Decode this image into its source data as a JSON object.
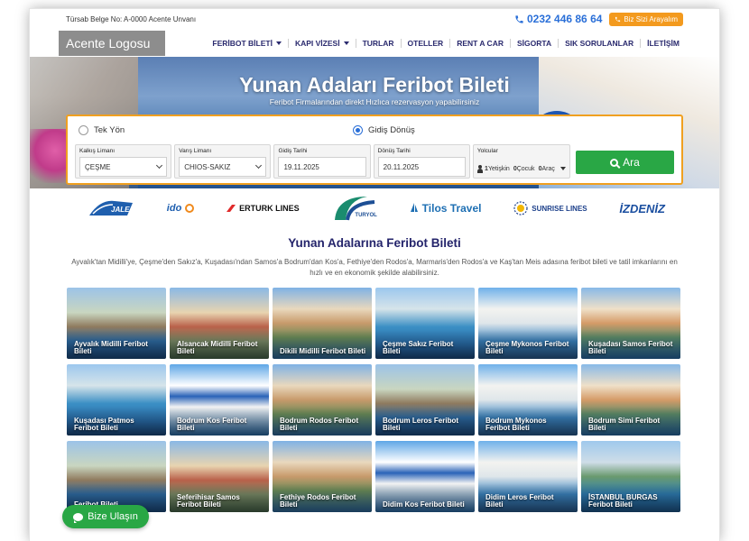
{
  "topbar": {
    "license": "Türsab Belge No: A-0000 Acente Unvanı",
    "phone": "0232 446 86 64",
    "callback_label": "Biz Sizi Arayalım"
  },
  "nav": {
    "logo": "Acente Logosu",
    "items": [
      {
        "label": "FERİBOT BİLETİ",
        "dropdown": true
      },
      {
        "label": "KAPI VİZESİ",
        "dropdown": true
      },
      {
        "label": "TURLAR",
        "dropdown": false
      },
      {
        "label": "OTELLER",
        "dropdown": false
      },
      {
        "label": "RENT A CAR",
        "dropdown": false
      },
      {
        "label": "SİGORTA",
        "dropdown": false
      },
      {
        "label": "SIK SORULANLAR",
        "dropdown": false
      },
      {
        "label": "İLETİŞİM",
        "dropdown": false
      }
    ]
  },
  "hero": {
    "title": "Yunan Adaları Feribot Bileti",
    "subtitle": "Feribot Firmalarından direkt Hızlıca rezervasyon yapabilirsiniz"
  },
  "search": {
    "one_way": "Tek Yön",
    "round_trip": "Gidiş Dönüş",
    "selected": "round_trip",
    "departure_label": "Kalkış Limanı",
    "departure_value": "ÇEŞME",
    "arrival_label": "Varış Limanı",
    "arrival_value": "CHIOS-SAKIZ",
    "depart_date_label": "Gidiş Tarihi",
    "depart_date": "19.11.2025",
    "return_date_label": "Dönüş Tarihi",
    "return_date": "20.11.2025",
    "passengers_label": "Yolcular",
    "adults": "1",
    "adults_label": "Yetişkin",
    "children": "0",
    "children_label": "Çocuk",
    "vehicles": "0",
    "vehicles_label": "Araç",
    "search_button": "Ara"
  },
  "companies": [
    "JALE",
    "ido",
    "ERTURK LINES",
    "TURYOL",
    "Tilos Travel",
    "SUNRISE LINES",
    "İZDENİZ"
  ],
  "section": {
    "title": "Yunan Adalarına Feribot Bileti",
    "description": "Ayvalık'tan Midilli'ye, Çeşme'den Sakız'a, Kuşadası'ndan Samos'a Bodrum'dan Kos'a, Fethiye'den Rodos'a, Marmaris'den Rodos'a ve Kaş'tan Meis adasına feribot bileti ve tatil imkanlarını en hızlı ve en ekonomik şekilde alabilirsiniz."
  },
  "routes": [
    {
      "label": "Ayvalık Midilli Feribot Bileti",
      "theme": "harbor"
    },
    {
      "label": "Alsancak Midilli Feribot Bileti",
      "theme": "church"
    },
    {
      "label": "Dikili Midilli Feribot Bileti",
      "theme": "hill"
    },
    {
      "label": "Çeşme Sakız Feribot Bileti",
      "theme": "bay"
    },
    {
      "label": "Çeşme Mykonos Feribot Bileti",
      "theme": "white"
    },
    {
      "label": "Kuşadası Samos Feribot Bileti",
      "theme": "town"
    },
    {
      "label": "Kuşadası Patmos Feribot Bileti",
      "theme": "bay"
    },
    {
      "label": "Bodrum Kos Feribot Bileti",
      "theme": "dome"
    },
    {
      "label": "Bodrum Rodos Feribot Bileti",
      "theme": "hill"
    },
    {
      "label": "Bodrum Leros Feribot Bileti",
      "theme": "harbor"
    },
    {
      "label": "Bodrum Mykonos Feribot Bileti",
      "theme": "white"
    },
    {
      "label": "Bodrum Simi Feribot Bileti",
      "theme": "town"
    },
    {
      "label": "Feribot Bileti",
      "theme": "harbor"
    },
    {
      "label": "Seferihisar Samos Feribot Bileti",
      "theme": "church"
    },
    {
      "label": "Fethiye Rodos Feribot Bileti",
      "theme": "hill"
    },
    {
      "label": "Didim Kos Feribot Bileti",
      "theme": "dome"
    },
    {
      "label": "Didim Leros Feribot Bileti",
      "theme": "white"
    },
    {
      "label": "İSTANBUL BURGAS Feribot Bileti",
      "theme": "coast"
    }
  ],
  "chat": {
    "label": "Bize Ulaşın"
  },
  "colors": {
    "brand_blue": "#2a6fd8",
    "nav_text": "#2a2a6e",
    "accent_orange": "#f39a1e",
    "cta_green": "#29a745"
  }
}
